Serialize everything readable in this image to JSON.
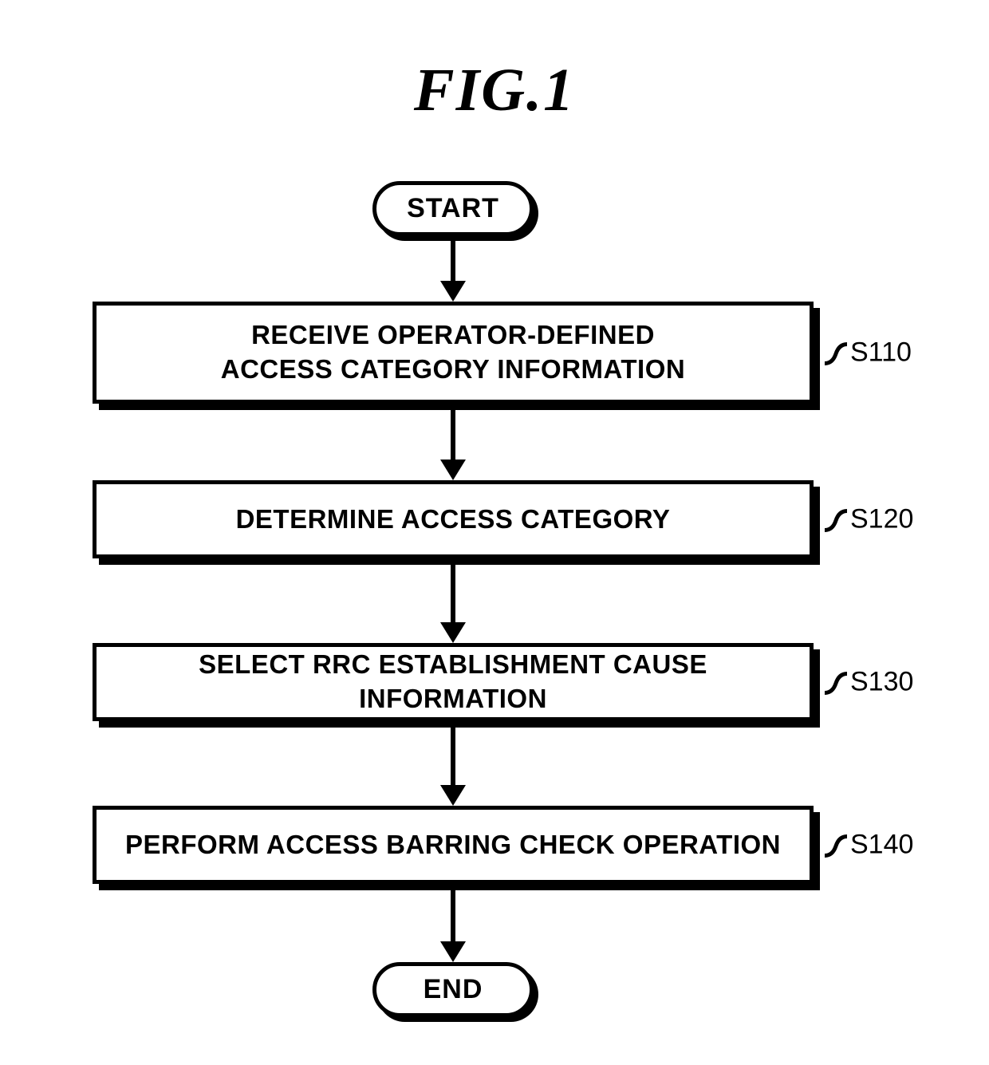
{
  "title": "FIG.1",
  "start_label": "START",
  "end_label": "END",
  "steps": [
    {
      "id": "S110",
      "text": "RECEIVE OPERATOR-DEFINED\nACCESS CATEGORY INFORMATION",
      "lines": 2
    },
    {
      "id": "S120",
      "text": "DETERMINE ACCESS CATEGORY",
      "lines": 1
    },
    {
      "id": "S130",
      "text": "SELECT RRC ESTABLISHMENT CAUSE INFORMATION",
      "lines": 1
    },
    {
      "id": "S140",
      "text": "PERFORM ACCESS BARRING CHECK OPERATION",
      "lines": 1
    }
  ]
}
